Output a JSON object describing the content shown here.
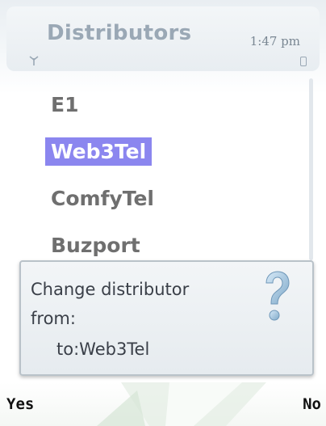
{
  "header": {
    "title": "Distributors",
    "time": "1:47 pm",
    "signal_icon": "signal-antenna-icon",
    "battery_icon": "battery-icon"
  },
  "distributors": {
    "items": [
      {
        "label": "E1",
        "selected": false
      },
      {
        "label": "Web3Tel",
        "selected": true
      },
      {
        "label": "ComfyTel",
        "selected": false
      },
      {
        "label": "Buzport",
        "selected": false
      }
    ]
  },
  "dialog": {
    "line1": "Change distributor",
    "line2": "from:",
    "line3": "to:Web3Tel",
    "icon": "question-mark-icon"
  },
  "softkeys": {
    "left_label": "Yes",
    "right_label": "No"
  },
  "colors": {
    "selection": "#8b86ef",
    "title": "#9aa8b5",
    "item_text": "#6f6f6f"
  }
}
